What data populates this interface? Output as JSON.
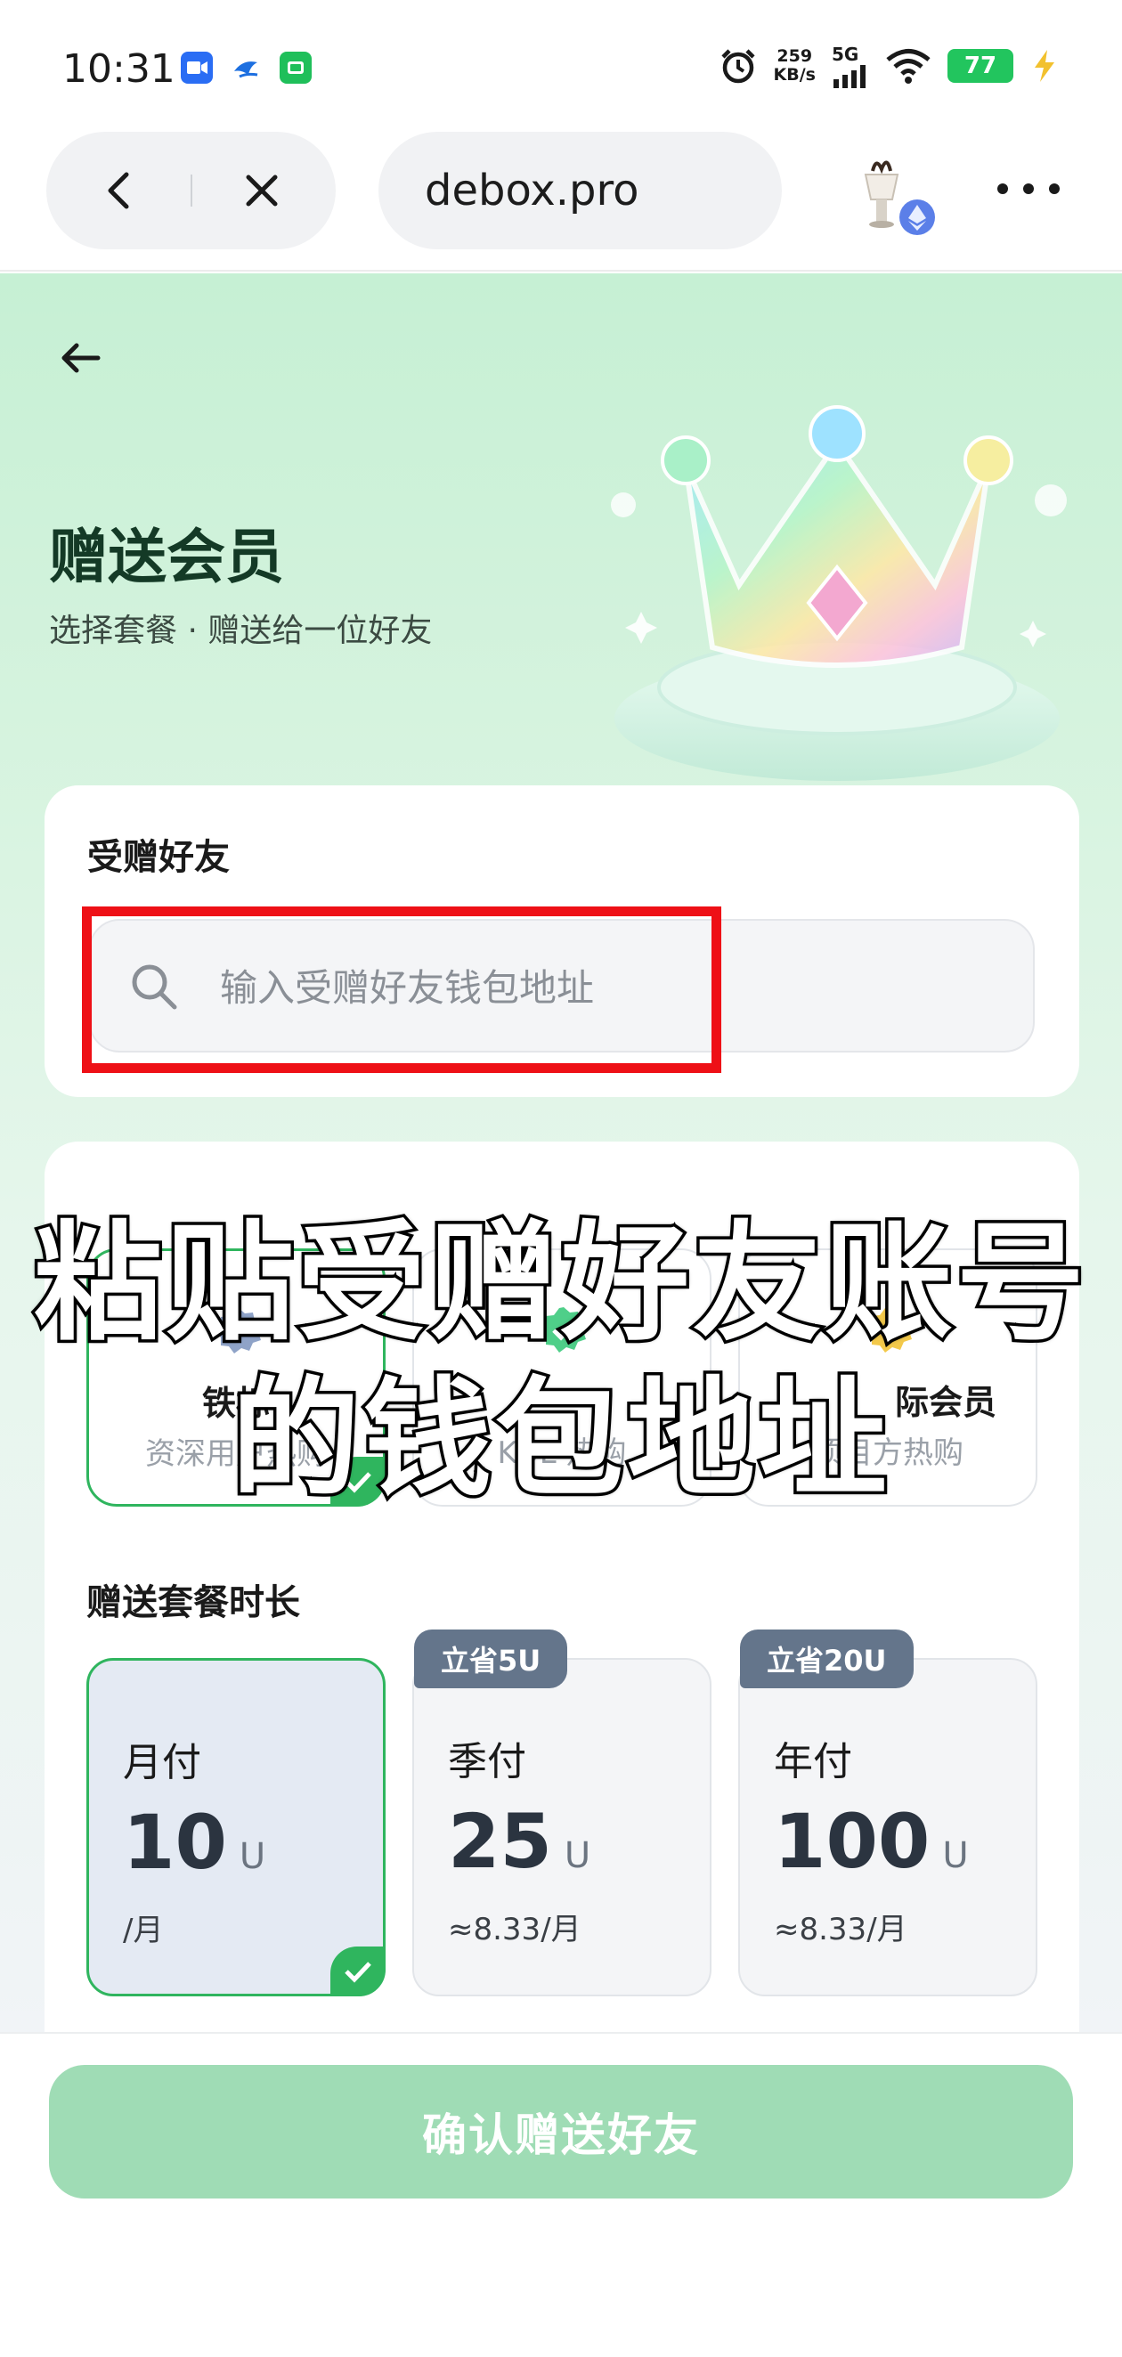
{
  "status_bar": {
    "time": "10:31",
    "net_speed_value": "259",
    "net_speed_unit": "KB/s",
    "network": "5G",
    "battery": "77"
  },
  "browser": {
    "url": "debox.pro",
    "icons": [
      "back-chevron-icon",
      "close-icon",
      "avatar-icon",
      "more-icon"
    ]
  },
  "page": {
    "title": "赠送会员",
    "subtitle": "选择套餐 · 赠送给一位好友",
    "friend_section": {
      "label": "受赠好友",
      "placeholder": "输入受赠好友钱包地址"
    },
    "tiers": [
      {
        "name": "铁标",
        "desc": "资深用户热购",
        "selected": true,
        "badge_color": "#8fa3c8"
      },
      {
        "name": "",
        "desc": "KOL 热购",
        "selected": false,
        "badge_color": "#4fcf89"
      },
      {
        "name": "际会员",
        "desc": "项目方热购",
        "selected": false,
        "badge_color": "#f3c94b"
      }
    ],
    "duration_section": {
      "label": "赠送套餐时长",
      "options": [
        {
          "tag": "",
          "name": "月付",
          "price": "10",
          "unit": "U",
          "note": "/月",
          "selected": true
        },
        {
          "tag": "立省5U",
          "name": "季付",
          "price": "25",
          "unit": "U",
          "note": "≈8.33/月",
          "selected": false
        },
        {
          "tag": "立省20U",
          "name": "年付",
          "price": "100",
          "unit": "U",
          "note": "≈8.33/月",
          "selected": false
        }
      ]
    },
    "confirm_label": "确认赠送好友"
  },
  "overlay": {
    "line1": "粘贴受赠好友账号",
    "line2": "的钱包地址"
  },
  "colors": {
    "accent_green": "#2fb55e",
    "button_disabled": "#9fdcb5",
    "highlight_red": "#ee1016",
    "tag_slate": "#64758b"
  }
}
